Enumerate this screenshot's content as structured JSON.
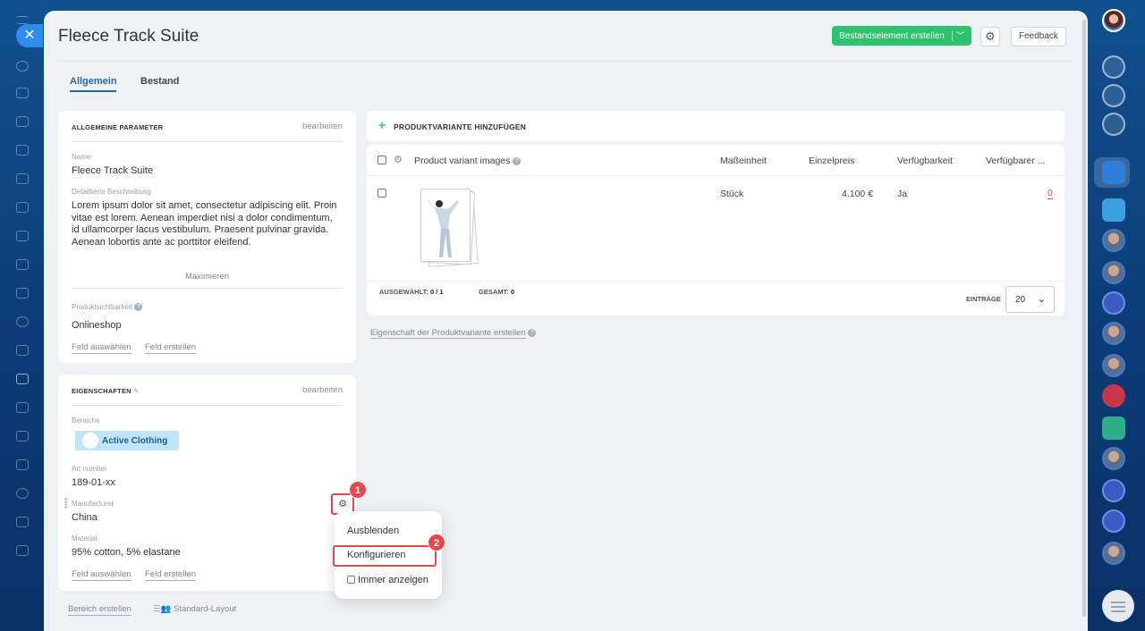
{
  "window": {
    "title": "Fleece Track Suite"
  },
  "header": {
    "create_button": "Bestandselement erstellen",
    "feedback_button": "Feedback"
  },
  "tabs": [
    {
      "label": "Allgemein",
      "active": true
    },
    {
      "label": "Bestand",
      "active": false
    }
  ],
  "general_params": {
    "title": "ALLGEMEINE PARAMETER",
    "edit": "bearbeiten",
    "name_label": "Name",
    "name_value": "Fleece Track Suite",
    "desc_label": "Detaillierte Beschreibung",
    "desc_value": "Lorem ipsum dolor sit amet, consectetur adipiscing elit. Proin vitae est lorem. Aenean imperdiet nisi a dolor condimentum, id ullamcorper lacus vestibulum. Praesent pulvinar gravida. Aenean lobortis ante ac porttitor eleifend.",
    "maximize": "Maximieren",
    "visibility_label": "Produktsichtbarkeit",
    "visibility_value": "Onlineshop",
    "select_field": "Feld auswählen",
    "create_field": "Feld erstellen"
  },
  "properties": {
    "title": "EIGENSCHAFTEN",
    "edit": "bearbeiten",
    "sections_label": "Bereiche",
    "section_tag": "Active Clothing",
    "art_label": "Art number",
    "art_value": "189-01-xx",
    "manufacturer_label": "Manufacturer",
    "manufacturer_value": "China",
    "material_label": "Material",
    "material_value": "95% cotton, 5% elastane",
    "select_field": "Feld auswählen",
    "create_field": "Feld erstellen"
  },
  "context_menu": {
    "items": [
      "Ausblenden",
      "Konfigurieren",
      "Immer anzeigen"
    ],
    "step1": "1",
    "step2": "2"
  },
  "variants": {
    "add_label": "PRODUKTVARIANTE HINZUFÜGEN",
    "columns": [
      "Product variant images",
      "Maßeinheit",
      "Einzelpreis",
      "Verfügbarkeit",
      "Verfügbarer ..."
    ],
    "rows": [
      {
        "unit": "Stück",
        "price": "4.100 €",
        "available": "Ja",
        "available_qty": "0"
      }
    ],
    "selected_label": "AUSGEWÄHLT:",
    "selected_value": "0 / 1",
    "total_label": "GESAMT:",
    "total_value": "0",
    "entries_label": "EINTRÄGE",
    "entries_value": "20"
  },
  "create_variant_property": "Eigenschaft der Produktvariante erstellen",
  "bottom": {
    "create_section": "Bereich erstellen",
    "standard_layout": "Standard-Layout"
  },
  "colors": {
    "accent_green": "#2fc26e",
    "highlight_red": "#e8474d",
    "tab_blue": "#2067b0",
    "tag_bg": "#bfe6f8"
  }
}
